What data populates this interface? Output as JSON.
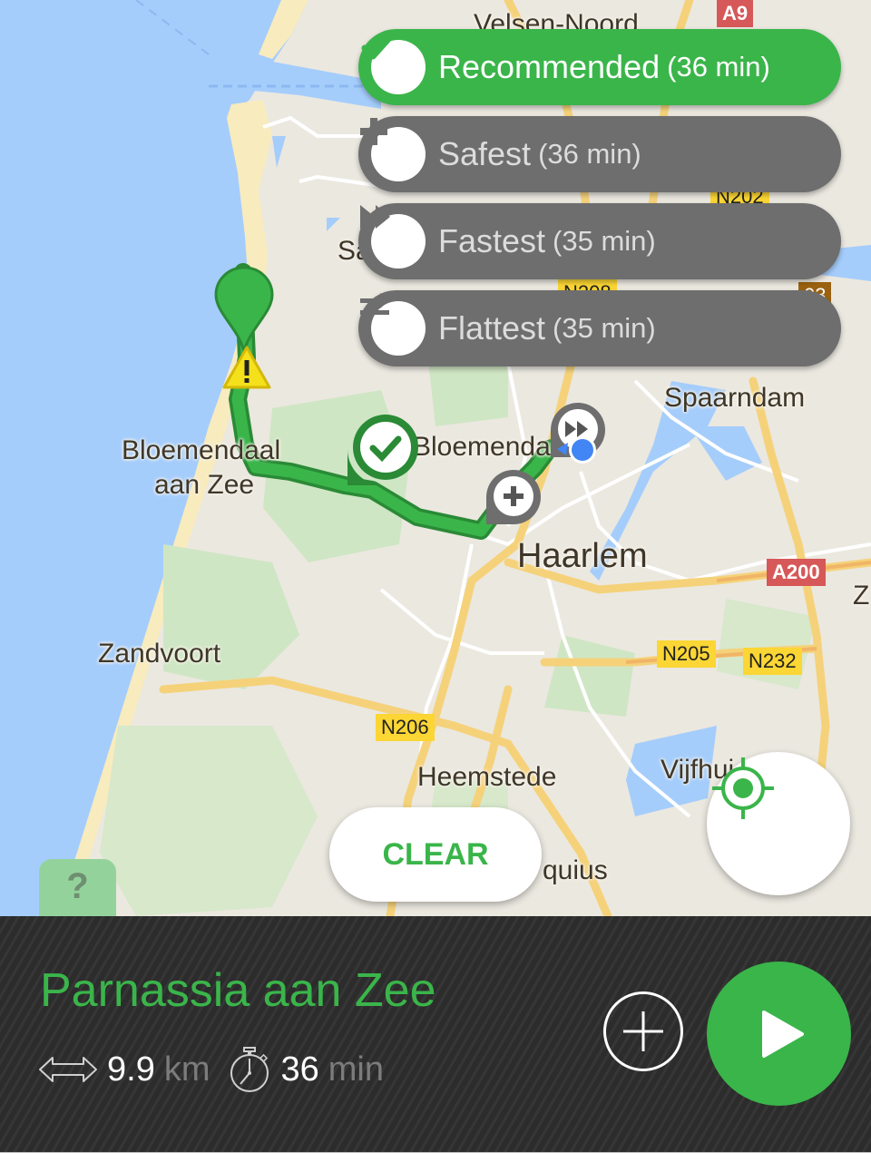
{
  "map": {
    "place_labels": {
      "velsen_noord": "Velsen-Noord",
      "santpoort": "Sa",
      "bloemendaal_aan_zee_line1": "Bloemendaal",
      "bloemendaal_aan_zee_line2": "aan Zee",
      "bloemendaal": "Bloemendaal",
      "spaarndam": "Spaarndam",
      "haarlem": "Haarlem",
      "zandvoort": "Zandvoort",
      "heemstede": "Heemstede",
      "vijfhuizen": "Vijfhui",
      "cruquius": "quius",
      "zwanenburg": "Z"
    },
    "road_shields": {
      "a9": "A9",
      "a200": "A200",
      "n205": "N205",
      "n232": "N232",
      "n206": "N206",
      "n202": "N202",
      "n208": "N208",
      "n203": "03"
    },
    "colors": {
      "water": "#a5cdfb",
      "land": "#ebe8e0",
      "park": "#cfe6c4",
      "beach": "#f8ebbd",
      "route": "#3ab54a",
      "route_dark": "#2a8a36"
    }
  },
  "route_options": [
    {
      "icon": "check-icon",
      "label": "Recommended",
      "time": "(36 min)",
      "selected": true
    },
    {
      "icon": "plus-icon",
      "label": "Safest",
      "time": "(36 min)",
      "selected": false
    },
    {
      "icon": "fast-forward-icon",
      "label": "Fastest",
      "time": "(35 min)",
      "selected": false
    },
    {
      "icon": "flat-arrow-icon",
      "label": "Flattest",
      "time": "(35 min)",
      "selected": false
    }
  ],
  "buttons": {
    "clear": "CLEAR",
    "help": "?"
  },
  "destination": {
    "name": "Parnassia aan Zee",
    "distance_value": "9.9",
    "distance_unit": "km",
    "duration_value": "36",
    "duration_unit": "min"
  },
  "theme": {
    "accent": "#3ab54a",
    "option_gray": "#6e6e6e",
    "panel_dark": "#2c2c2c"
  }
}
